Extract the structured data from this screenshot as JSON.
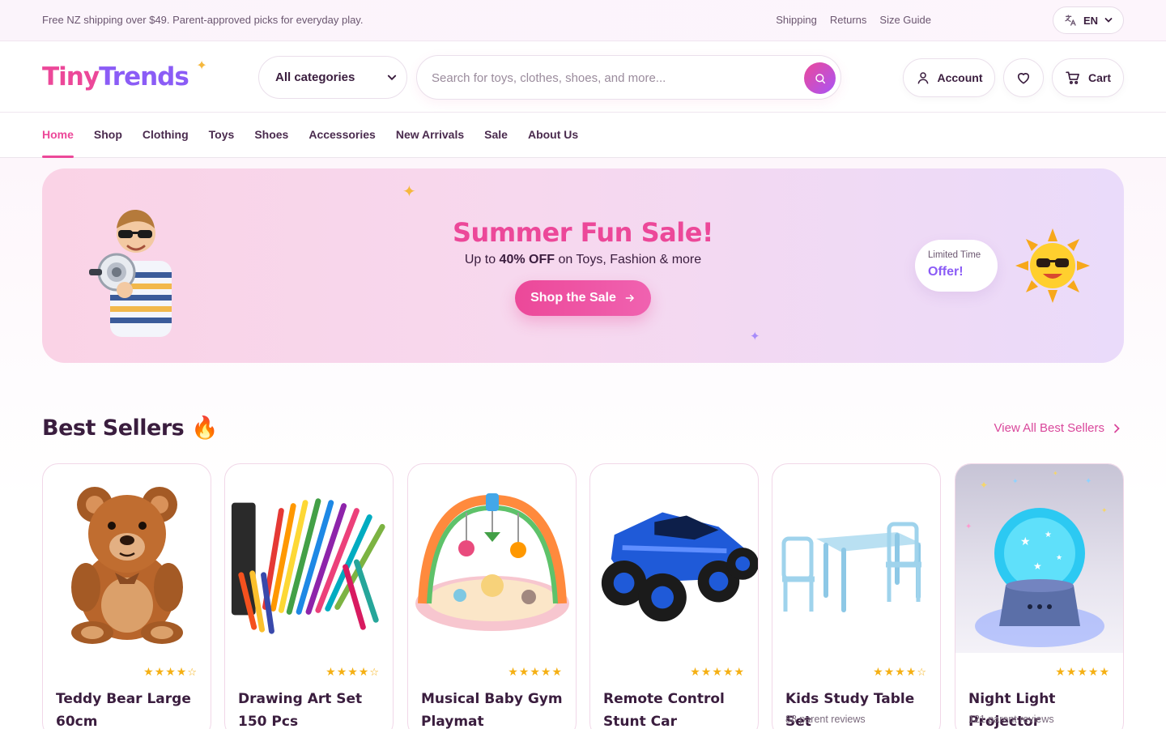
{
  "topbar": {
    "promo": "Free NZ shipping over $49. Parent-approved picks for everyday play.",
    "links": [
      "Shipping",
      "Returns",
      "Size Guide"
    ],
    "language": "EN"
  },
  "header": {
    "logo_part1": "Tiny",
    "logo_part2": "Trends",
    "category_select": "All categories",
    "search_placeholder": "Search for toys, clothes, shoes, and more...",
    "account_label": "Account",
    "cart_label": "Cart"
  },
  "nav": {
    "items": [
      "Home",
      "Shop",
      "Clothing",
      "Toys",
      "Shoes",
      "Accessories",
      "New Arrivals",
      "Sale",
      "About Us"
    ],
    "active": "Home"
  },
  "hero": {
    "title": "Summer Fun Sale!",
    "subtitle_pre": "Up to",
    "subtitle_bold": "40% OFF",
    "subtitle_post": "on Toys, Fashion & more",
    "cta": "Shop the Sale",
    "badge_line1": "Limited Time",
    "badge_line2": "Offer!"
  },
  "best_sellers": {
    "title": "Best Sellers 🔥",
    "view_all": "View All Best Sellers",
    "products": [
      {
        "name": "Teddy Bear Large 60cm",
        "rating": 4,
        "reviews": ""
      },
      {
        "name": "Drawing Art Set 150 Pcs",
        "rating": 4,
        "reviews": ""
      },
      {
        "name": "Musical Baby Gym Playmat",
        "rating": 5,
        "reviews": ""
      },
      {
        "name": "Remote Control Stunt Car",
        "rating": 5,
        "reviews": ""
      },
      {
        "name": "Kids Study Table Set",
        "rating": 4,
        "reviews": "88 parent reviews"
      },
      {
        "name": "Night Light Projector",
        "rating": 5,
        "reviews": "121 parent reviews"
      }
    ]
  },
  "colors": {
    "brand_pink": "#ec4899",
    "brand_purple": "#8b5cf6",
    "star": "#f5b014"
  }
}
